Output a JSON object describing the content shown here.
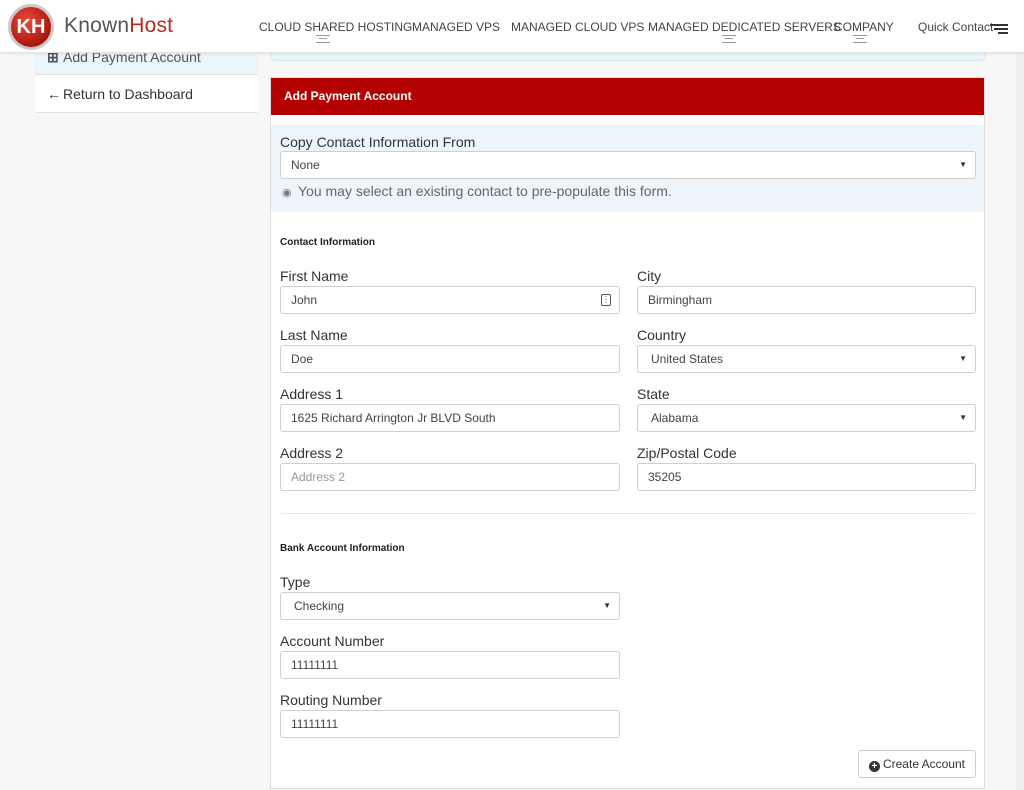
{
  "brand": {
    "logo_mark": "KH",
    "name_part1": "Known",
    "name_part2": "Host"
  },
  "nav": {
    "items": [
      "CLOUD SHARED HOSTING",
      "MANAGED VPS",
      "MANAGED CLOUD VPS",
      "MANAGED DEDICATED SERVERS",
      "COMPANY"
    ],
    "quick_contact": "Quick Contact"
  },
  "sidebar": {
    "add_payment": "Add Payment Account",
    "return_dashboard": "Return to Dashboard"
  },
  "panel": {
    "title": "Add Payment Account",
    "copy_label": "Copy Contact Information From",
    "copy_value": "None",
    "copy_hint": "You may select an existing contact to pre-populate this form.",
    "contact_title": "Contact Information",
    "bank_title": "Bank Account Information"
  },
  "form": {
    "first_name_label": "First Name",
    "first_name": "John",
    "last_name_label": "Last Name",
    "last_name": "Doe",
    "address1_label": "Address 1",
    "address1": "1625 Richard Arrington Jr BLVD South",
    "address2_label": "Address 2",
    "address2_placeholder": "Address 2",
    "city_label": "City",
    "city": "Birmingham",
    "country_label": "Country",
    "country": "United States",
    "state_label": "State",
    "state": "Alabama",
    "zip_label": "Zip/Postal Code",
    "zip": "35205",
    "type_label": "Type",
    "type": "Checking",
    "account_label": "Account Number",
    "account": "11111111",
    "routing_label": "Routing Number",
    "routing": "11111111",
    "submit": "Create Account"
  },
  "colors": {
    "header_red": "#b30000",
    "info_blue": "#edf5fb"
  },
  "icons": [
    "plus-square-icon",
    "arrow-left-icon",
    "lightbulb-icon",
    "caret-down-icon",
    "plus-circle-icon",
    "menu-icon",
    "autofill-icon"
  ]
}
